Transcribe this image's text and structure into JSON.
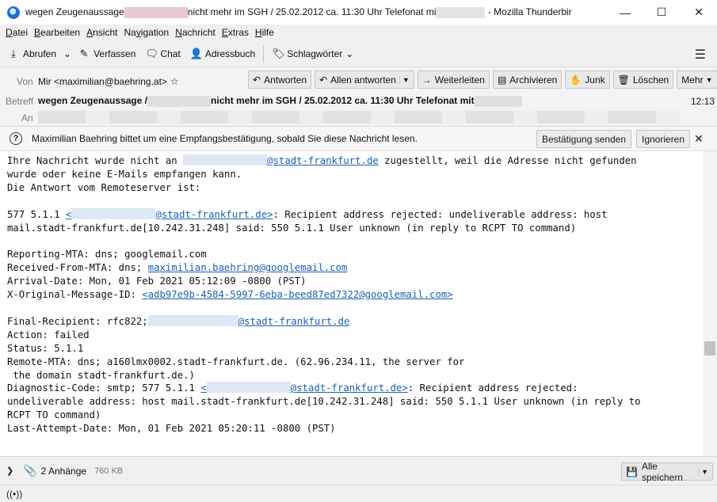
{
  "window": {
    "title_part1": "wegen Zeugenaussage",
    "title_part2": "nicht mehr im SGH / 25.02.2012 ca. 11:30 Uhr Telefonat mi",
    "title_part3": "- Mozilla Thunderbird",
    "minimize": "—",
    "maximize": "☐",
    "close": "✕"
  },
  "menu": {
    "file": {
      "key": "D",
      "rest": "atei"
    },
    "edit": {
      "key": "B",
      "rest": "earbeiten"
    },
    "view": {
      "key": "A",
      "rest": "nsicht"
    },
    "nav": {
      "pre": "Na",
      "key": "v",
      "rest": "igation"
    },
    "message": {
      "key": "N",
      "rest": "achricht"
    },
    "extras": {
      "key": "E",
      "rest": "xtras"
    },
    "help": {
      "key": "H",
      "rest": "ilfe"
    }
  },
  "toolbar": {
    "fetch": "Abrufen",
    "compose": "Verfassen",
    "chat": "Chat",
    "addressbook": "Adressbuch",
    "tags": "Schlagwörter"
  },
  "header": {
    "from_label": "Von",
    "from_value": "Mir <maximilian@baehring.at>",
    "subject_label": "Betreff",
    "subject_part1": "wegen Zeugenaussage /",
    "subject_part2": "nicht mehr im SGH / 25.02.2012 ca. 11:30 Uhr Telefonat mit",
    "time": "12:13",
    "to_label": "An",
    "buttons": {
      "reply": "Antworten",
      "reply_all": "Allen antworten",
      "forward": "Weiterleiten",
      "archive": "Archivieren",
      "junk": "Junk",
      "delete": "Löschen",
      "more": "Mehr"
    }
  },
  "notice": {
    "text": "Maximilian Baehring bittet um eine Empfangsbestätigung, sobald Sie diese Nachricht lesen.",
    "confirm": "Bestätigung senden",
    "ignore": "Ignorieren"
  },
  "body": {
    "l1a": "Ihre Nachricht wurde nicht an ",
    "l1link": "@stadt-frankfurt.de",
    "l1b": " zugestellt, weil die Adresse nicht gefunden",
    "l2": "wurde oder keine E-Mails empfangen kann.",
    "l3": "Die Antwort vom Remoteserver ist:",
    "l5a": "577 5.1.1 ",
    "l5link1": "<",
    "l5link2": "@stadt-frankfurt.de>",
    "l5b": ": Recipient address rejected: undeliverable address: host",
    "l6": "mail.stadt-frankfurt.de[10.242.31.248] said: 550 5.1.1 User unknown (in reply to RCPT TO command)",
    "l8": "Reporting-MTA: dns; googlemail.com",
    "l9a": "Received-From-MTA: dns; ",
    "l9link": "maximilian.baehring@googlemail.com",
    "l10": "Arrival-Date: Mon, 01 Feb 2021 05:12:09 -0800 (PST)",
    "l11a": "X-Original-Message-ID: ",
    "l11link": "<adb97e9b-4584-5997-6eba-beed87ed7322@googlemail.com>",
    "l13a": "Final-Recipient: rfc822;",
    "l13link": "@stadt-frankfurt.de",
    "l14": "Action: failed",
    "l15": "Status: 5.1.1",
    "l16": "Remote-MTA: dns; a160lmx0002.stadt-frankfurt.de. (62.96.234.11, the server for",
    "l17": " the domain stadt-frankfurt.de.)",
    "l18a": "Diagnostic-Code: smtp; 577 5.1.1 ",
    "l18link1": "<",
    "l18link2": "@stadt-frankfurt.de>",
    "l18b": ": Recipient address rejected:",
    "l19": "undeliverable address: host mail.stadt-frankfurt.de[10.242.31.248] said: 550 5.1.1 User unknown (in reply to",
    "l20": "RCPT TO command)",
    "l21": "Last-Attempt-Date: Mon, 01 Feb 2021 05:20:11 -0800 (PST)"
  },
  "attachments": {
    "count": "2 Anhänge",
    "size": "760 KB",
    "save_all": "Alle speichern"
  },
  "status": {
    "icon": "((•))"
  }
}
